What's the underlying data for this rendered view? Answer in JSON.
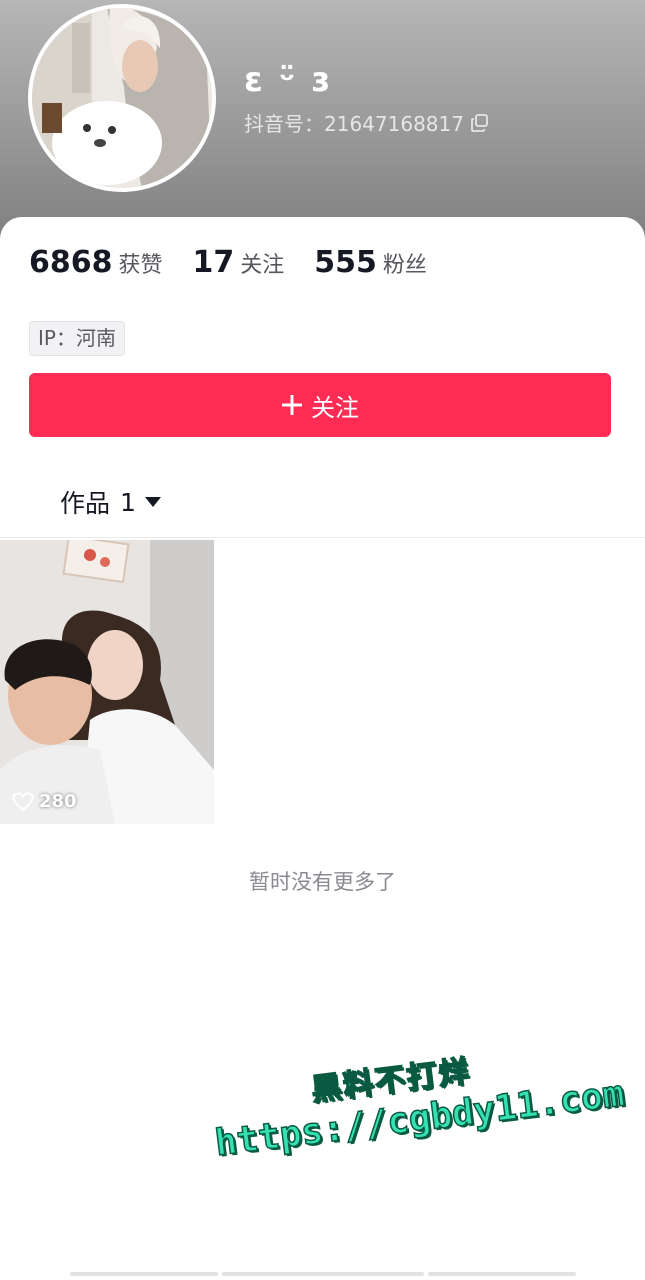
{
  "profile": {
    "nickname": "ɛ ᵕ̈ ɜ",
    "douyin_id_label": "抖音号：21647168817",
    "avatar_icon": "user-avatar-photo"
  },
  "stats": [
    {
      "value": "6868",
      "label": "获赞"
    },
    {
      "value": "17",
      "label": "关注"
    },
    {
      "value": "555",
      "label": "粉丝"
    }
  ],
  "ip_tag": "IP：河南",
  "follow_button": {
    "label": "关注",
    "icon": "plus-icon",
    "color": "#fe2c55"
  },
  "works_tab": {
    "label": "作品",
    "count": "1",
    "icon": "caret-down-icon"
  },
  "videos": [
    {
      "likes": "280",
      "icon": "heart-outline-icon"
    }
  ],
  "empty_text": "暂时没有更多了",
  "watermark": {
    "line1": "黑料不打烊",
    "line2": "https://cgbdy11.com",
    "color": "#35e0b3"
  }
}
